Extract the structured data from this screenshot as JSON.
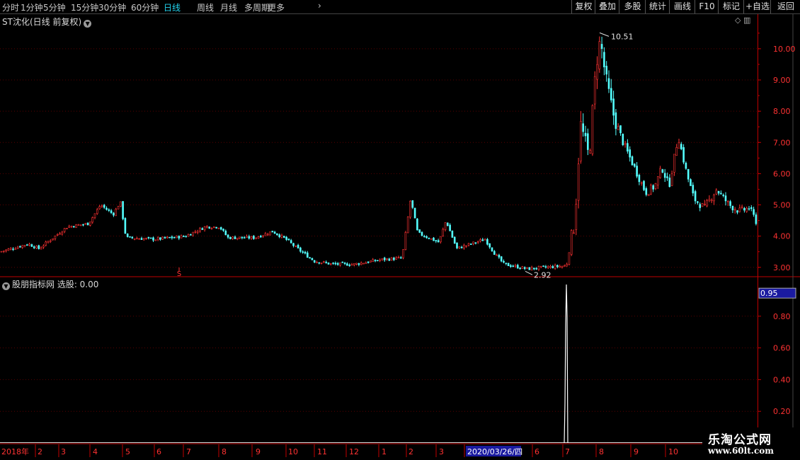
{
  "toolbar": {
    "periods": [
      "分时",
      "1分钟",
      "5分钟",
      "15分钟",
      "30分钟",
      "60分钟",
      "日线",
      "周线",
      "月线",
      "多周期",
      "更多"
    ],
    "active_period": "日线",
    "more_arrow": "›",
    "right_buttons": [
      "复权",
      "叠加",
      "多股",
      "统计",
      "画线",
      "F10",
      "标记",
      "+自选",
      "返回"
    ]
  },
  "price_panel": {
    "title": "ST沈化(日线 前复权)",
    "high_label": "10.51",
    "low_label": "2.92",
    "signal_mark": "S",
    "y_ticks": [
      "10.00",
      "9.00",
      "8.00",
      "7.00",
      "6.00",
      "5.00",
      "4.00",
      "3.00"
    ]
  },
  "indicator_panel": {
    "title": "股朋指标网 选股: 0.00",
    "current_value": "0.95",
    "y_ticks": [
      "0.80",
      "0.60",
      "0.40",
      "0.20"
    ]
  },
  "x_axis": {
    "labels": [
      "2018年",
      "2",
      "3",
      "4",
      "5",
      "6",
      "7",
      "8",
      "9",
      "10",
      "11",
      "12",
      "1",
      "2",
      "3",
      "2020/03/26/四",
      "6",
      "7",
      "8",
      "9",
      "10"
    ]
  },
  "watermark": {
    "name": "乐淘公式网",
    "url": "www.60lt.com"
  },
  "colors": {
    "up": "#ff3232",
    "down": "#54ffff",
    "axis": "#c00000",
    "grid": "#5a0000",
    "highlight_bg": "#1a1aa0"
  },
  "chart_data": [
    {
      "type": "candlestick",
      "title": "ST沈化(日线 前复权)",
      "ylim": [
        2.7,
        10.7
      ],
      "annotations": [
        {
          "label": "10.51",
          "value": 10.51
        },
        {
          "label": "2.92",
          "value": 2.92
        }
      ],
      "close_series_approx": {
        "x": [
          "2018-01",
          "2018-02",
          "2018-03",
          "2018-04",
          "2018-05",
          "2018-06",
          "2018-07",
          "2018-08",
          "2018-09",
          "2018-10",
          "2018-11",
          "2018-12",
          "2019-01",
          "2019-02",
          "2019-03",
          "2019-04",
          "2019-06",
          "2019-07",
          "2019-08",
          "2019-09",
          "2019-10"
        ],
        "values": [
          3.55,
          3.7,
          4.1,
          4.85,
          3.95,
          3.9,
          4.0,
          4.2,
          3.95,
          3.8,
          3.2,
          3.1,
          3.25,
          4.2,
          3.6,
          3.35,
          2.98,
          5.5,
          9.6,
          5.6,
          5.1
        ]
      }
    },
    {
      "type": "line",
      "title": "股朋指标网 选股",
      "ylim": [
        0,
        1.0
      ],
      "current_value": 0.95,
      "signal_spike": {
        "x": "2019-07",
        "value": 1.0
      }
    }
  ]
}
